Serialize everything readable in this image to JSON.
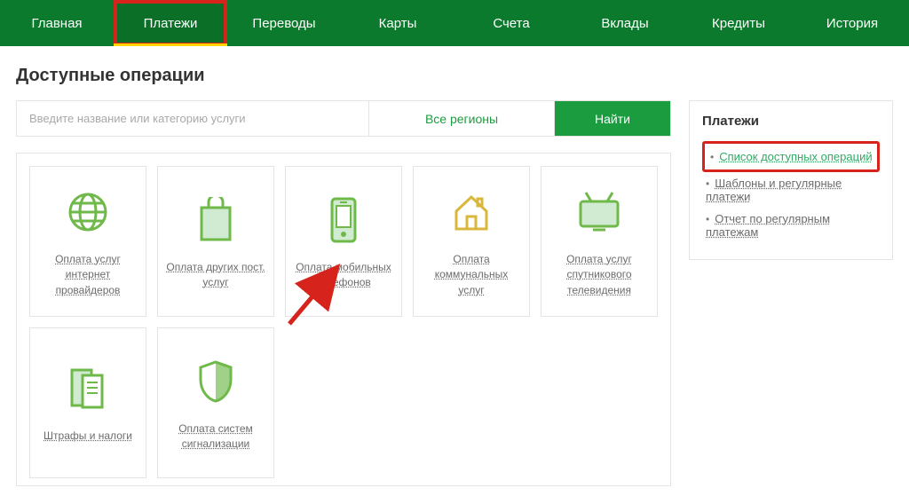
{
  "nav": {
    "items": [
      "Главная",
      "Платежи",
      "Переводы",
      "Карты",
      "Счета",
      "Вклады",
      "Кредиты",
      "История"
    ],
    "active_index": 1
  },
  "page": {
    "heading": "Доступные операции"
  },
  "search": {
    "placeholder": "Введите название или категорию услуги",
    "region_label": "Все регионы",
    "find_label": "Найти"
  },
  "tiles": [
    {
      "icon": "globe-icon",
      "label": "Оплата услуг интернет провайдеров"
    },
    {
      "icon": "bag-icon",
      "label": "Оплата других пост. услуг"
    },
    {
      "icon": "phone-icon",
      "label": "Оплата мобильных телефонов"
    },
    {
      "icon": "house-icon",
      "label": "Оплата коммунальных услуг"
    },
    {
      "icon": "tv-icon",
      "label": "Оплата услуг спутникового телевидения"
    },
    {
      "icon": "receipt-icon",
      "label": "Штрафы и налоги"
    },
    {
      "icon": "shield-icon",
      "label": "Оплата систем сигнализации"
    }
  ],
  "sidebar": {
    "title": "Платежи",
    "links": [
      "Список доступных операций",
      "Шаблоны и регулярные платежи",
      "Отчет по регулярным платежам"
    ]
  },
  "colors": {
    "brand_green": "#0c7a2c",
    "accent_green": "#1a9c3f",
    "highlight_red": "#d6231c"
  }
}
